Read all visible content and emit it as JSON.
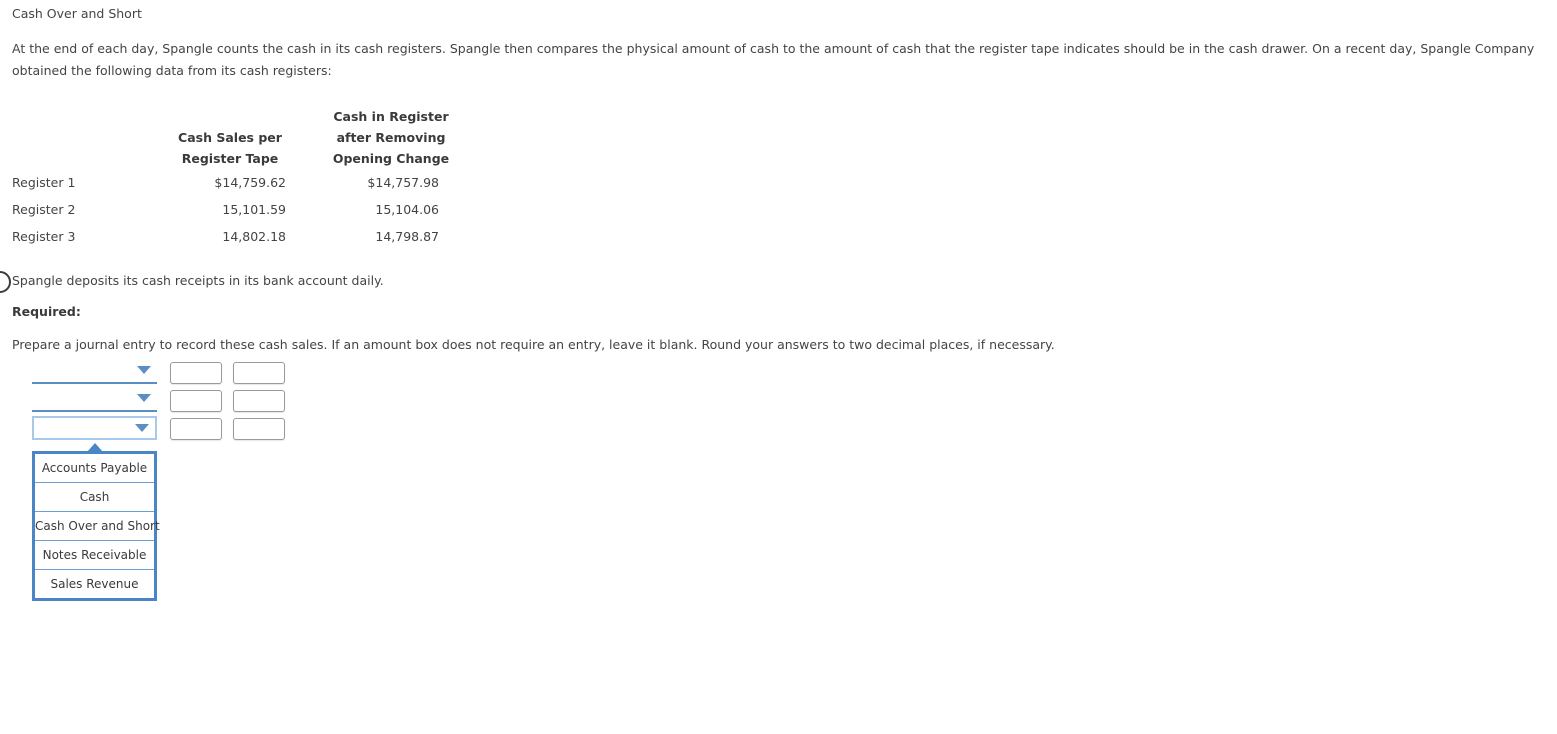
{
  "page": {
    "title": "Cash Over and Short",
    "intro_paragraph": "At the end of each day, Spangle counts the cash in its cash registers. Spangle then compares the physical amount of cash to the amount of cash that the register tape indicates should be in the cash drawer. On a recent day, Spangle Company obtained the following data from its cash registers:",
    "deposit_note": "Spangle deposits its cash receipts in its bank account daily.",
    "required_label": "Required:",
    "instruction": "Prepare a journal entry to record these cash sales. If an amount box does not require an entry, leave it blank. Round your answers to two decimal places, if necessary."
  },
  "table": {
    "headers": {
      "corner": "",
      "col1_line1": "Cash Sales per",
      "col1_line2": "Register Tape",
      "col2_line1": "Cash in Register",
      "col2_line2": "after Removing",
      "col2_line3": "Opening Change"
    },
    "rows": [
      {
        "label": "Register 1",
        "cash_sales": "$14,759.62",
        "cash_in_register": "$14,757.98"
      },
      {
        "label": "Register 2",
        "cash_sales": "15,101.59",
        "cash_in_register": "15,104.06"
      },
      {
        "label": "Register 3",
        "cash_sales": "14,802.18",
        "cash_in_register": "14,798.87"
      }
    ]
  },
  "journal_form": {
    "rows": [
      {
        "account_value": "",
        "debit_value": "",
        "credit_value": ""
      },
      {
        "account_value": "",
        "debit_value": "",
        "credit_value": ""
      },
      {
        "account_value": "",
        "debit_value": "",
        "credit_value": ""
      }
    ],
    "open_dropdown_row_index": 2,
    "dropdown_options": [
      "Accounts Payable",
      "Cash",
      "Cash Over and Short",
      "Notes Receivable",
      "Sales Revenue"
    ]
  },
  "colors": {
    "select_underline": "#5b8fc4",
    "select_focus_border": "#a9c9ea",
    "dropdown_border": "#4a86c5",
    "caret_blue": "#5b8fc4",
    "input_border": "#9a9a9a",
    "text": "#444444"
  }
}
